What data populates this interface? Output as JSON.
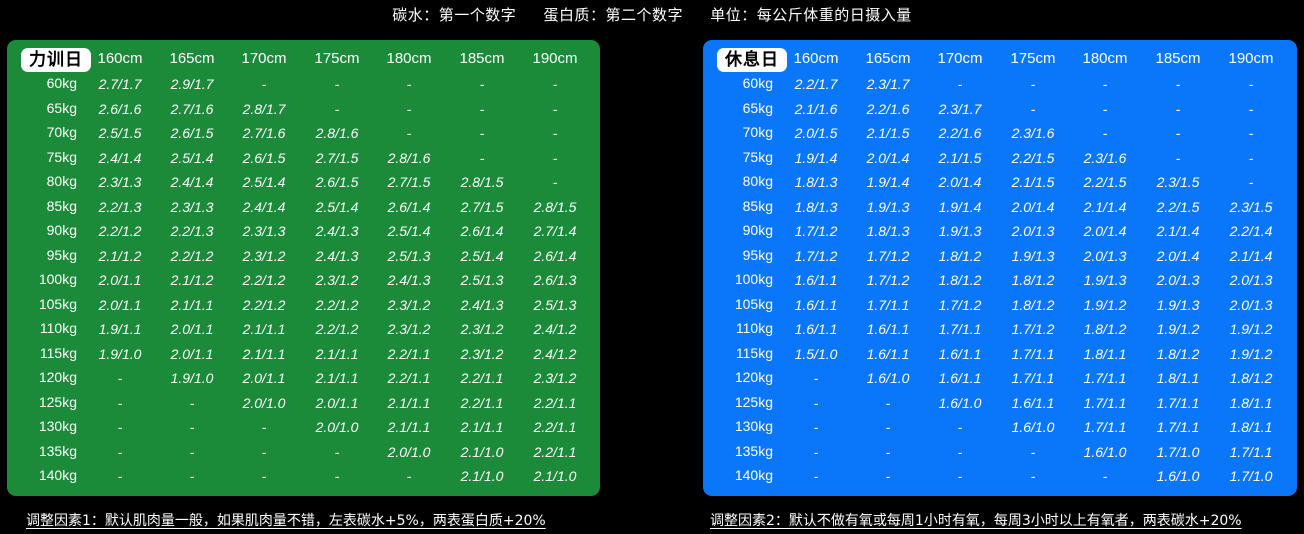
{
  "legend": {
    "carb": "碳水：第一个数字",
    "protein": "蛋白质：第二个数字",
    "unit": "单位：每公斤体重的日摄入量"
  },
  "heights": [
    "160cm",
    "165cm",
    "170cm",
    "175cm",
    "180cm",
    "185cm",
    "190cm"
  ],
  "weights": [
    "60kg",
    "65kg",
    "70kg",
    "75kg",
    "80kg",
    "85kg",
    "90kg",
    "95kg",
    "100kg",
    "105kg",
    "110kg",
    "115kg",
    "120kg",
    "125kg",
    "130kg",
    "135kg",
    "140kg"
  ],
  "training": {
    "title": "力训日",
    "rows": [
      [
        "2.7/1.7",
        "2.9/1.7",
        "-",
        "-",
        "-",
        "-",
        "-"
      ],
      [
        "2.6/1.6",
        "2.7/1.6",
        "2.8/1.7",
        "-",
        "-",
        "-",
        "-"
      ],
      [
        "2.5/1.5",
        "2.6/1.5",
        "2.7/1.6",
        "2.8/1.6",
        "-",
        "-",
        "-"
      ],
      [
        "2.4/1.4",
        "2.5/1.4",
        "2.6/1.5",
        "2.7/1.5",
        "2.8/1.6",
        "-",
        "-"
      ],
      [
        "2.3/1.3",
        "2.4/1.4",
        "2.5/1.4",
        "2.6/1.5",
        "2.7/1.5",
        "2.8/1.5",
        "-"
      ],
      [
        "2.2/1.3",
        "2.3/1.3",
        "2.4/1.4",
        "2.5/1.4",
        "2.6/1.4",
        "2.7/1.5",
        "2.8/1.5"
      ],
      [
        "2.2/1.2",
        "2.2/1.3",
        "2.3/1.3",
        "2.4/1.3",
        "2.5/1.4",
        "2.6/1.4",
        "2.7/1.4"
      ],
      [
        "2.1/1.2",
        "2.2/1.2",
        "2.3/1.2",
        "2.4/1.3",
        "2.5/1.3",
        "2.5/1.4",
        "2.6/1.4"
      ],
      [
        "2.0/1.1",
        "2.1/1.2",
        "2.2/1.2",
        "2.3/1.2",
        "2.4/1.3",
        "2.5/1.3",
        "2.6/1.3"
      ],
      [
        "2.0/1.1",
        "2.1/1.1",
        "2.2/1.2",
        "2.2/1.2",
        "2.3/1.2",
        "2.4/1.3",
        "2.5/1.3"
      ],
      [
        "1.9/1.1",
        "2.0/1.1",
        "2.1/1.1",
        "2.2/1.2",
        "2.3/1.2",
        "2.3/1.2",
        "2.4/1.2"
      ],
      [
        "1.9/1.0",
        "2.0/1.1",
        "2.1/1.1",
        "2.1/1.1",
        "2.2/1.1",
        "2.3/1.2",
        "2.4/1.2"
      ],
      [
        "-",
        "1.9/1.0",
        "2.0/1.1",
        "2.1/1.1",
        "2.2/1.1",
        "2.2/1.1",
        "2.3/1.2"
      ],
      [
        "-",
        "-",
        "2.0/1.0",
        "2.0/1.1",
        "2.1/1.1",
        "2.2/1.1",
        "2.2/1.1"
      ],
      [
        "-",
        "-",
        "-",
        "2.0/1.0",
        "2.1/1.1",
        "2.1/1.1",
        "2.2/1.1"
      ],
      [
        "-",
        "-",
        "-",
        "-",
        "2.0/1.0",
        "2.1/1.0",
        "2.2/1.1"
      ],
      [
        "-",
        "-",
        "-",
        "-",
        "-",
        "2.1/1.0",
        "2.1/1.0"
      ]
    ]
  },
  "rest": {
    "title": "休息日",
    "rows": [
      [
        "2.2/1.7",
        "2.3/1.7",
        "-",
        "-",
        "-",
        "-",
        "-"
      ],
      [
        "2.1/1.6",
        "2.2/1.6",
        "2.3/1.7",
        "-",
        "-",
        "-",
        "-"
      ],
      [
        "2.0/1.5",
        "2.1/1.5",
        "2.2/1.6",
        "2.3/1.6",
        "-",
        "-",
        "-"
      ],
      [
        "1.9/1.4",
        "2.0/1.4",
        "2.1/1.5",
        "2.2/1.5",
        "2.3/1.6",
        "-",
        "-"
      ],
      [
        "1.8/1.3",
        "1.9/1.4",
        "2.0/1.4",
        "2.1/1.5",
        "2.2/1.5",
        "2.3/1.5",
        "-"
      ],
      [
        "1.8/1.3",
        "1.9/1.3",
        "1.9/1.4",
        "2.0/1.4",
        "2.1/1.4",
        "2.2/1.5",
        "2.3/1.5"
      ],
      [
        "1.7/1.2",
        "1.8/1.3",
        "1.9/1.3",
        "2.0/1.3",
        "2.0/1.4",
        "2.1/1.4",
        "2.2/1.4"
      ],
      [
        "1.7/1.2",
        "1.7/1.2",
        "1.8/1.2",
        "1.9/1.3",
        "2.0/1.3",
        "2.0/1.4",
        "2.1/1.4"
      ],
      [
        "1.6/1.1",
        "1.7/1.2",
        "1.8/1.2",
        "1.8/1.2",
        "1.9/1.3",
        "2.0/1.3",
        "2.0/1.3"
      ],
      [
        "1.6/1.1",
        "1.7/1.1",
        "1.7/1.2",
        "1.8/1.2",
        "1.9/1.2",
        "1.9/1.3",
        "2.0/1.3"
      ],
      [
        "1.6/1.1",
        "1.6/1.1",
        "1.7/1.1",
        "1.7/1.2",
        "1.8/1.2",
        "1.9/1.2",
        "1.9/1.2"
      ],
      [
        "1.5/1.0",
        "1.6/1.1",
        "1.6/1.1",
        "1.7/1.1",
        "1.8/1.1",
        "1.8/1.2",
        "1.9/1.2"
      ],
      [
        "-",
        "1.6/1.0",
        "1.6/1.1",
        "1.7/1.1",
        "1.7/1.1",
        "1.8/1.1",
        "1.8/1.2"
      ],
      [
        "-",
        "-",
        "1.6/1.0",
        "1.6/1.1",
        "1.7/1.1",
        "1.7/1.1",
        "1.8/1.1"
      ],
      [
        "-",
        "-",
        "-",
        "1.6/1.0",
        "1.7/1.1",
        "1.7/1.1",
        "1.8/1.1"
      ],
      [
        "-",
        "-",
        "-",
        "-",
        "1.6/1.0",
        "1.7/1.0",
        "1.7/1.1"
      ],
      [
        "-",
        "-",
        "-",
        "-",
        "-",
        "1.6/1.0",
        "1.7/1.0"
      ]
    ]
  },
  "footnotes": {
    "left": "调整因素1：默认肌肉量一般，如果肌肉量不错，左表碳水+5%，两表蛋白质+20%",
    "right": "调整因素2：默认不做有氧或每周1小时有氧，每周3小时以上有氧者，两表碳水+20%"
  },
  "colors": {
    "training_panel": "#1b8a39",
    "rest_panel": "#0a77fb",
    "background": "#000000"
  }
}
